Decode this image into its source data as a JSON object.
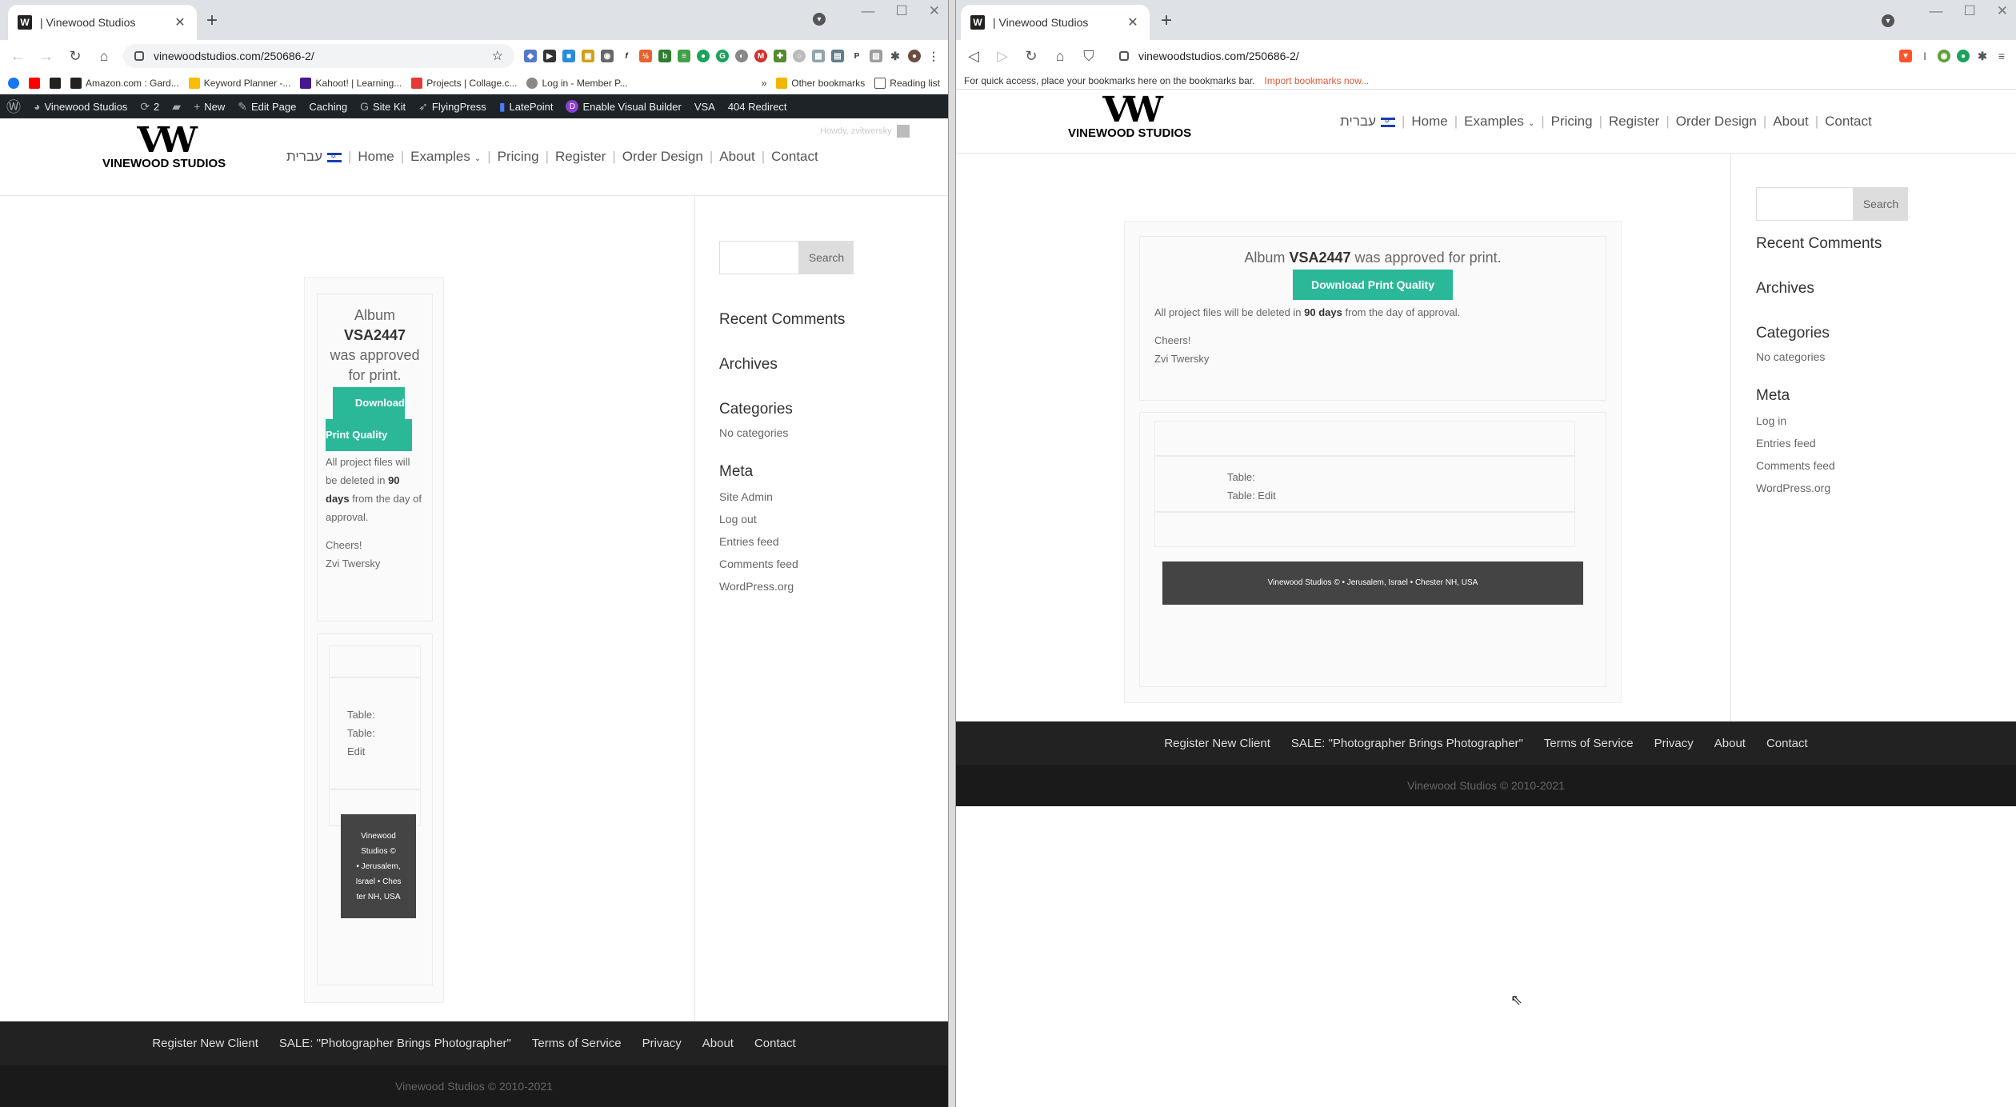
{
  "left": {
    "tab_title": "| Vinewood Studios",
    "url": "vinewoodstudios.com/250686-2/",
    "bookmarks": [
      "Amazon.com : Gard...",
      "Keyword Planner -...",
      "Kahoot! | Learning...",
      "Projects | Collage.c...",
      "Log in - Member P..."
    ],
    "bookmarks_more": "»",
    "other_bookmarks": "Other bookmarks",
    "reading_list": "Reading list",
    "admin": {
      "site": "Vinewood Studios",
      "updates": "2",
      "new": "New",
      "edit_page": "Edit Page",
      "caching": "Caching",
      "site_kit": "Site Kit",
      "flyingpress": "FlyingPress",
      "latepoint": "LatePoint",
      "visual_builder": "Enable Visual Builder",
      "vsa": "VSA",
      "redirect": "404 Redirect",
      "howdy": "Howdy, zvitwersky"
    }
  },
  "right": {
    "tab_title": "| Vinewood Studios",
    "url": "vinewoodstudios.com/250686-2/",
    "bookmarks_hint": "For quick access, place your bookmarks here on the bookmarks bar.",
    "import_link": "Import bookmarks now..."
  },
  "site": {
    "logo_mark": "VW",
    "logo_text": "VINEWOOD STUDIOS",
    "nav": {
      "hebrew": "עברית",
      "home": "Home",
      "examples": "Examples",
      "pricing": "Pricing",
      "register": "Register",
      "order_design": "Order Design",
      "about": "About",
      "contact": "Contact"
    },
    "album_pre": "Album",
    "album_id": "VSA2447",
    "album_post": "was approved for print.",
    "download_btn": "Download Print Quality",
    "download_btn_1": "Download",
    "download_btn_2": "Print Quality",
    "delete_pre": "All project files will be deleted in",
    "delete_days": "90 days",
    "delete_post": "from the day of approval.",
    "cheers": "Cheers!",
    "signature": "Zvi Twersky",
    "table_label": "Table:",
    "table_edit": "Table: Edit",
    "table_edit_1": "Table:",
    "table_edit_2": "Edit",
    "dark_bar": "Vinewood Studios © • Jerusalem, Israel • Chester NH, USA",
    "dark_bar_lines": [
      "Vinewood",
      "Studios ©",
      "• Jerusalem,",
      "Israel • Ches",
      "ter NH, USA"
    ],
    "search_btn": "Search",
    "widgets": {
      "recent_comments": "Recent Comments",
      "archives": "Archives",
      "categories": "Categories",
      "no_categories": "No categories",
      "meta": "Meta",
      "site_admin": "Site Admin",
      "log_out": "Log out",
      "log_in": "Log in",
      "entries_feed": "Entries feed",
      "comments_feed": "Comments feed",
      "wordpress_org": "WordPress.org"
    },
    "footer": {
      "register": "Register New Client",
      "sale": "SALE: \"Photographer Brings Photographer\"",
      "terms": "Terms of Service",
      "privacy": "Privacy",
      "about": "About",
      "contact": "Contact",
      "copyright": "Vinewood Studios © 2010-2021"
    }
  },
  "colors": {
    "accent": "#2ab899",
    "admin_bar": "#1d2327",
    "footer": "#222222",
    "footer_bottom": "#1a1a1a",
    "import_link": "#e05a3a"
  }
}
